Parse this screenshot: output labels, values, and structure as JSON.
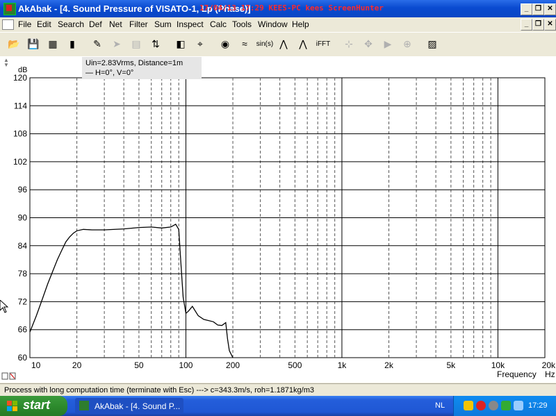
{
  "window": {
    "title": "AkAbak - [4. Sound Pressure of VISATO-1, Lp (Phase)]",
    "overlay_watermark": "17/04/13 17:29 KEES-PC kees ScreenHunter"
  },
  "menu": [
    "File",
    "Edit",
    "Search",
    "Def",
    "Net",
    "Filter",
    "Sum",
    "Inspect",
    "Calc",
    "Tools",
    "Window",
    "Help"
  ],
  "toolbar": {
    "buttons": [
      {
        "name": "open-icon",
        "glyph": "📂",
        "enabled": true
      },
      {
        "name": "save-icon",
        "glyph": "💾",
        "enabled": true
      },
      {
        "name": "network-icon",
        "glyph": "▦",
        "enabled": true
      },
      {
        "name": "driver-icon",
        "glyph": "▮",
        "enabled": true
      },
      {
        "name": "edit-icon",
        "glyph": "✎",
        "enabled": true
      },
      {
        "name": "arrow-icon",
        "glyph": "➤",
        "enabled": false
      },
      {
        "name": "grid-icon",
        "glyph": "▤",
        "enabled": false
      },
      {
        "name": "scale-icon",
        "glyph": "⇅",
        "enabled": true
      },
      {
        "name": "speaker-icon",
        "glyph": "◧",
        "enabled": true
      },
      {
        "name": "target-icon",
        "glyph": "⌖",
        "enabled": true
      },
      {
        "name": "source-icon",
        "glyph": "◉",
        "enabled": true
      },
      {
        "name": "filter-icon",
        "glyph": "≈",
        "enabled": true
      },
      {
        "name": "sine-button",
        "glyph": "sin(s)",
        "enabled": true
      },
      {
        "name": "response-icon",
        "glyph": "⋀",
        "enabled": true
      },
      {
        "name": "response-add-icon",
        "glyph": "⋀",
        "enabled": true
      },
      {
        "name": "ifft-button",
        "glyph": "iFFT",
        "enabled": true
      },
      {
        "name": "zoom-icon",
        "glyph": "⊹",
        "enabled": false
      },
      {
        "name": "pan-icon",
        "glyph": "✥",
        "enabled": false
      },
      {
        "name": "play-icon",
        "glyph": "▶",
        "enabled": false
      },
      {
        "name": "crosshair-icon",
        "glyph": "⊕",
        "enabled": false
      },
      {
        "name": "plot-icon",
        "glyph": "▨",
        "enabled": true
      }
    ]
  },
  "info": {
    "line1": "Uin=2.83Vrms, Distance=1m",
    "line2": "— H=0°, V=0°"
  },
  "status": "Process with long computation time (terminate with Esc) ---> c=343.3m/s, roh=1.1871kg/m3",
  "taskbar": {
    "start": "start",
    "task_label": "AkAbak - [4. Sound P...",
    "lang": "NL",
    "clock": "17:29"
  },
  "chart_data": {
    "type": "line",
    "ylabel": "dB",
    "xlabel": "Frequency",
    "xunit": "Hz",
    "xscale": "log",
    "xlim": [
      10,
      20000
    ],
    "ylim": [
      60,
      120
    ],
    "yticks": [
      120,
      114,
      108,
      102,
      96,
      90,
      84,
      78,
      72,
      66,
      60
    ],
    "xticks": [
      {
        "v": 10,
        "label": "10"
      },
      {
        "v": 20,
        "label": "20"
      },
      {
        "v": 50,
        "label": "50"
      },
      {
        "v": 100,
        "label": "100"
      },
      {
        "v": 200,
        "label": "200"
      },
      {
        "v": 500,
        "label": "500"
      },
      {
        "v": 1000,
        "label": "1k"
      },
      {
        "v": 2000,
        "label": "2k"
      },
      {
        "v": 5000,
        "label": "5k"
      },
      {
        "v": 10000,
        "label": "10k"
      },
      {
        "v": 20000,
        "label": "20k"
      }
    ],
    "grid": true,
    "series": [
      {
        "color": "#000000",
        "x": [
          10,
          11,
          12,
          13,
          14,
          15,
          16,
          17,
          18,
          19,
          20,
          22,
          25,
          30,
          40,
          50,
          60,
          70,
          80,
          86,
          90,
          93,
          96,
          100,
          104,
          110,
          120,
          130,
          150,
          160,
          170,
          180,
          185,
          190,
          200
        ],
        "y": [
          65.5,
          69,
          72.5,
          75.8,
          78.5,
          81,
          83,
          84.8,
          85.9,
          86.7,
          87.2,
          87.5,
          87.4,
          87.4,
          87.6,
          87.9,
          88,
          87.8,
          88,
          88.6,
          87.5,
          80,
          73,
          69.5,
          70,
          71,
          69,
          68.2,
          67.7,
          67,
          66.9,
          67.5,
          64,
          61.5,
          59
        ]
      }
    ]
  }
}
